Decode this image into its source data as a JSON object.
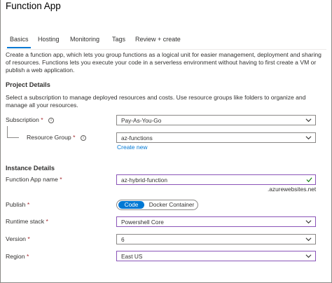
{
  "app": {
    "title": "Function App"
  },
  "tabs": [
    {
      "label": "Basics",
      "active": true
    },
    {
      "label": "Hosting"
    },
    {
      "label": "Monitoring"
    },
    {
      "label": "Tags"
    },
    {
      "label": "Review + create"
    }
  ],
  "intro": "Create a function app, which lets you group functions as a logical unit for easier management, deployment and sharing of resources. Functions lets you execute your code in a serverless environment without having to first create a VM or publish a web application.",
  "project": {
    "heading": "Project Details",
    "description": "Select a subscription to manage deployed resources and costs. Use resource groups like folders to organize and manage all your resources.",
    "subscription": {
      "label": "Subscription",
      "required": "*",
      "value": "Pay-As-You-Go"
    },
    "resource_group": {
      "label": "Resource Group",
      "required": "*",
      "value": "az-functions",
      "create_link": "Create new"
    }
  },
  "instance": {
    "heading": "Instance Details",
    "name": {
      "label": "Function App name",
      "required": "*",
      "value": "az-hybrid-function",
      "suffix": ".azurewebsites.net"
    },
    "publish": {
      "label": "Publish",
      "required": "*",
      "options": [
        "Code",
        "Docker Container"
      ],
      "selected": "Code"
    },
    "runtime": {
      "label": "Runtime stack",
      "required": "*",
      "value": "Powershell Core"
    },
    "version": {
      "label": "Version",
      "required": "*",
      "value": "6"
    },
    "region": {
      "label": "Region",
      "required": "*",
      "value": "East US"
    }
  },
  "colors": {
    "accent": "#0078d4",
    "focus_border": "#8a54b8",
    "required": "#a4262c",
    "valid": "#107c10"
  },
  "icons": {
    "info": "info-icon",
    "chevron": "chevron-down-icon",
    "valid": "checkmark-icon"
  }
}
